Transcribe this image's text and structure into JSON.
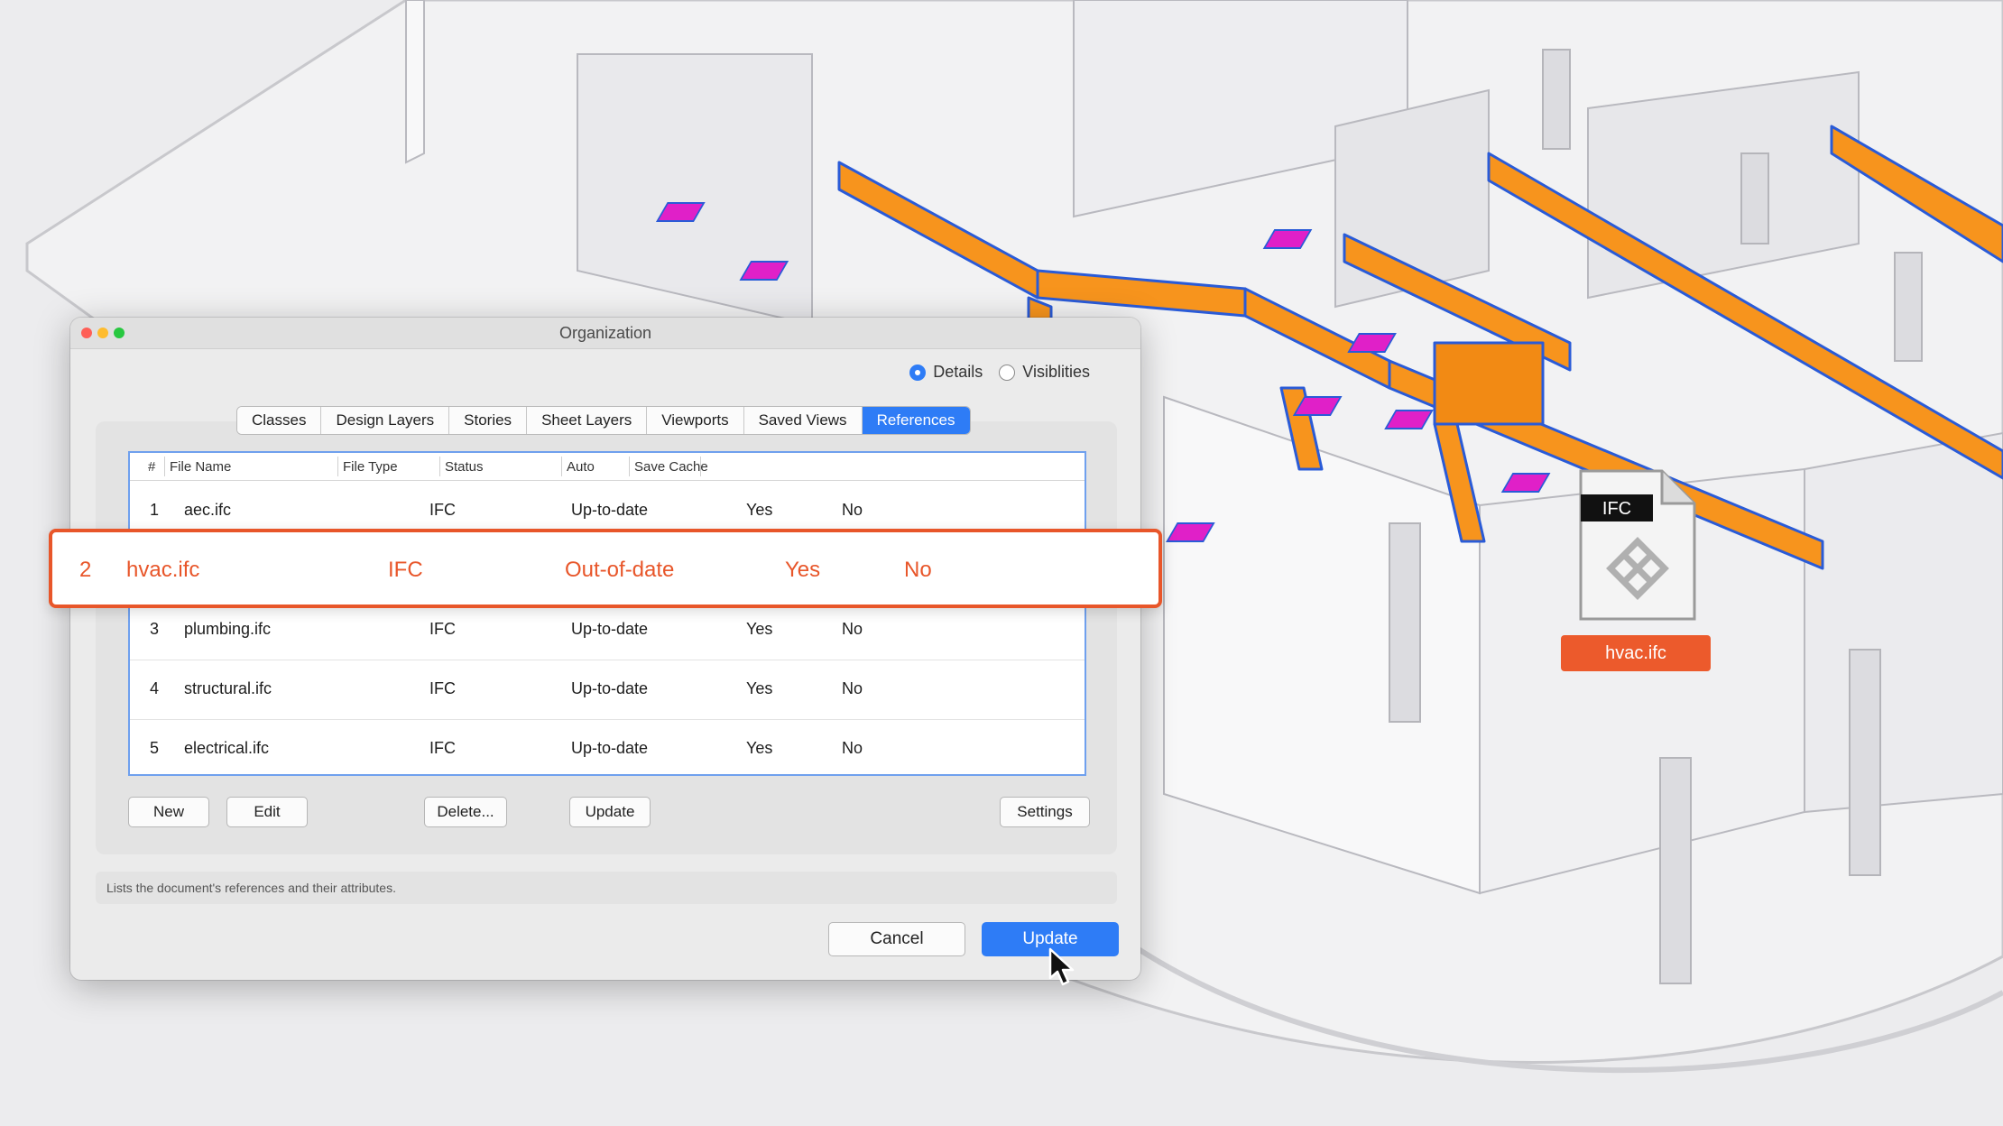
{
  "window": {
    "title": "Organization"
  },
  "view_mode": {
    "options": [
      "Details",
      "Visiblities"
    ],
    "selected": "Details"
  },
  "tabs": [
    "Classes",
    "Design Layers",
    "Stories",
    "Sheet Layers",
    "Viewports",
    "Saved Views",
    "References"
  ],
  "active_tab": "References",
  "table": {
    "columns": [
      "#",
      "File Name",
      "File Type",
      "Status",
      "Auto",
      "Save Cache"
    ],
    "rows": [
      {
        "num": "1",
        "file": "aec.ifc",
        "type": "IFC",
        "status": "Up-to-date",
        "auto": "Yes",
        "cache": "No"
      },
      {
        "num": "2",
        "file": "hvac.ifc",
        "type": "IFC",
        "status": "Out-of-date",
        "auto": "Yes",
        "cache": "No"
      },
      {
        "num": "3",
        "file": "plumbing.ifc",
        "type": "IFC",
        "status": "Up-to-date",
        "auto": "Yes",
        "cache": "No"
      },
      {
        "num": "4",
        "file": "structural.ifc",
        "type": "IFC",
        "status": "Up-to-date",
        "auto": "Yes",
        "cache": "No"
      },
      {
        "num": "5",
        "file": "electrical.ifc",
        "type": "IFC",
        "status": "Up-to-date",
        "auto": "Yes",
        "cache": "No"
      }
    ]
  },
  "buttons": {
    "new": "New",
    "edit": "Edit",
    "delete": "Delete...",
    "update": "Update",
    "settings": "Settings"
  },
  "hint": "Lists the document's references and their attributes.",
  "footer": {
    "cancel": "Cancel",
    "update": "Update"
  },
  "file_badge": {
    "type": "IFC",
    "name": "hvac.ifc"
  },
  "colors": {
    "accent": "#2e7cf6",
    "highlight": "#e8562a",
    "duct": "#f7941d",
    "diffuser": "#e020c8"
  }
}
